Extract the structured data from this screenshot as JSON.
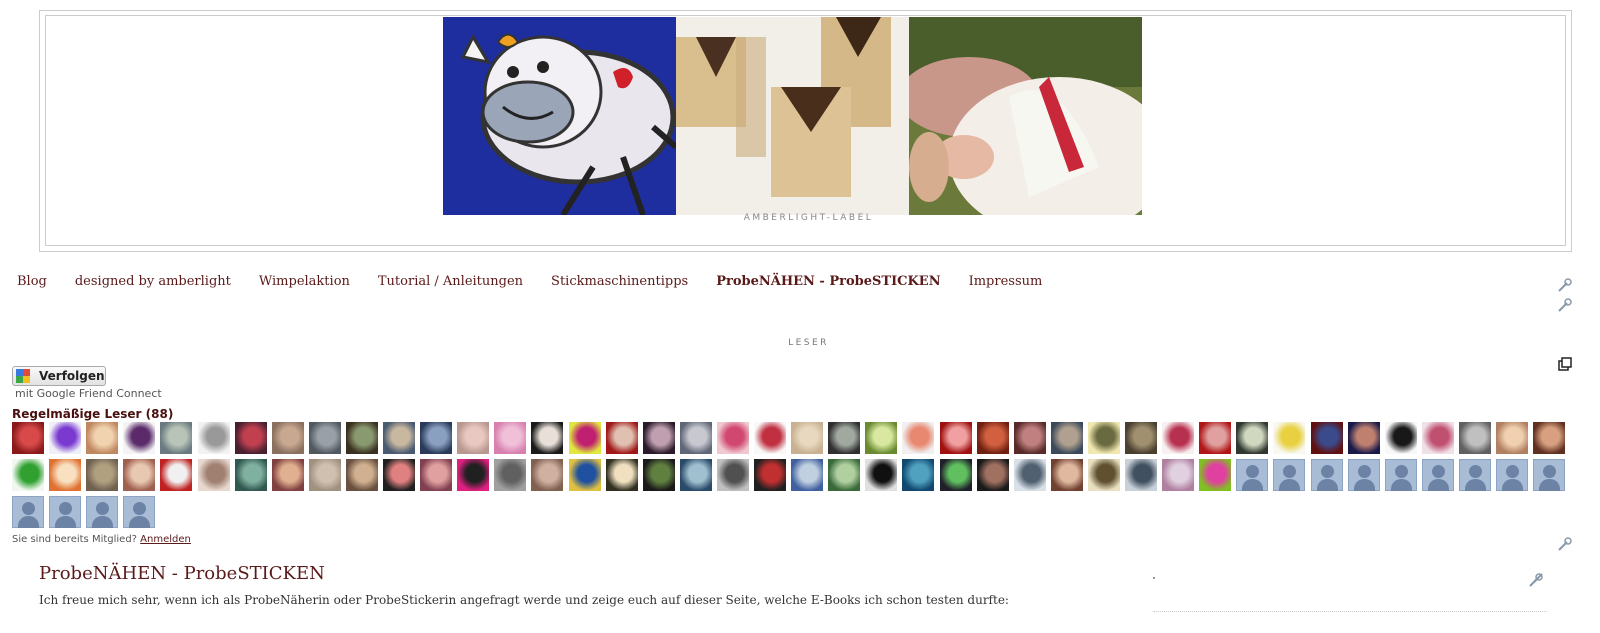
{
  "header": {
    "description": "AMBERLIGHT-LABEL"
  },
  "nav": {
    "items": [
      {
        "label": "Blog",
        "current": false
      },
      {
        "label": "designed by amberlight",
        "current": false
      },
      {
        "label": "Wimpelaktion",
        "current": false
      },
      {
        "label": "Tutorial / Anleitungen",
        "current": false
      },
      {
        "label": "Stickmaschinentipps",
        "current": false
      },
      {
        "label": "ProbeNÄHEN - ProbeSTICKEN",
        "current": true
      },
      {
        "label": "Impressum",
        "current": false
      }
    ]
  },
  "followers": {
    "section_title": "LESER",
    "follow_button": "Verfolgen",
    "provider_text": "mit Google Friend Connect",
    "regular_readers": "Regelmäßige Leser (88)",
    "member_question": "Sie sind bereits Mitglied?",
    "login_link": "Anmelden"
  },
  "post": {
    "title": "ProbeNÄHEN - ProbeSTICKEN",
    "body": "Ich freue mich sehr, wenn ich als ProbeNäherin oder ProbeStickerin angefragt werde und zeige euch auf dieser Seite, welche E-Books ich schon testen durfte:"
  },
  "colors": {
    "link": "#5a1a1a",
    "border": "#cccccc",
    "default_avatar": "#a8bcd6"
  }
}
